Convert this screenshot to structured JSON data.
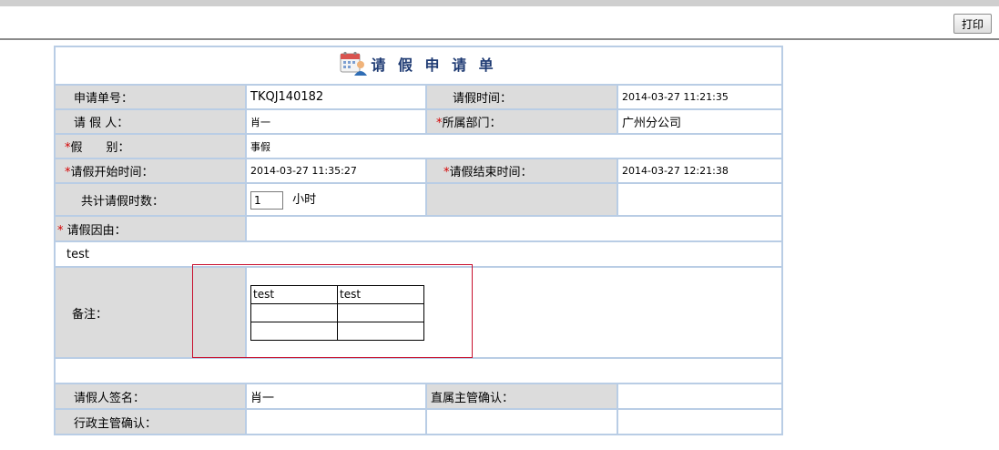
{
  "toolbar": {
    "print_label": "打印"
  },
  "form": {
    "title": "请 假 申 请 单",
    "icon": "calendar-person-icon",
    "req_mark": "*",
    "labels": {
      "application_no": "申请单号：",
      "leave_time": "请假时间：",
      "applicant": "请 假 人：",
      "department": "所属部门：",
      "leave_type": "假　　别：",
      "start_time": "请假开始时间：",
      "end_time": "请假结束时间：",
      "total_hours": "共计请假时数：",
      "reason": " 请假因由：",
      "remarks": "备注：",
      "applicant_signature": "请假人签名：",
      "supervisor_confirm": "直属主管确认：",
      "admin_confirm": "行政主管确认："
    },
    "values": {
      "application_no": "TKQJ140182",
      "leave_time": "2014-03-27 11:21:35",
      "applicant": "肖一",
      "department": "广州分公司",
      "leave_type": "事假",
      "start_time": "2014-03-27 11:35:27",
      "end_time": "2014-03-27 12:21:38",
      "total_hours": "1",
      "hours_unit": "小时",
      "reason": "test",
      "applicant_signature": "肖一",
      "supervisor_confirm": "",
      "admin_confirm": ""
    },
    "remarks_table": [
      [
        "test",
        "test"
      ],
      [
        "",
        ""
      ],
      [
        "",
        ""
      ]
    ]
  },
  "colors": {
    "border": "#b9cde5",
    "label_bg": "#dcdcdc",
    "required": "#d40000",
    "title": "#1f3b73",
    "highlight_box": "#c8102e"
  }
}
